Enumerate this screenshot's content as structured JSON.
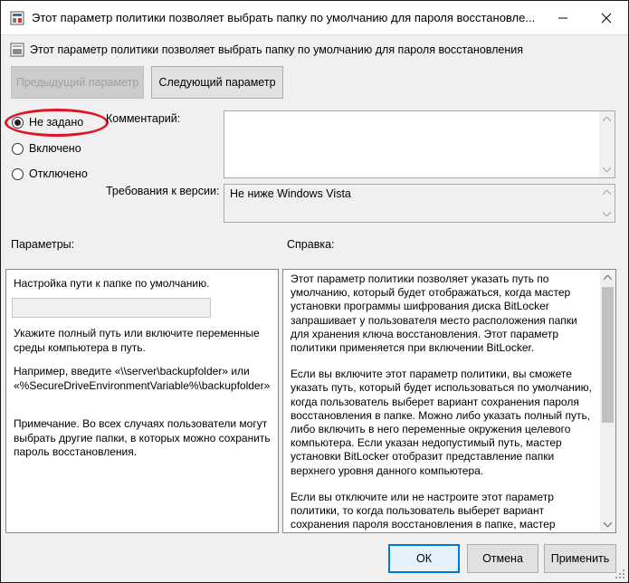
{
  "window": {
    "title": "Этот параметр политики позволяет выбрать папку по умолчанию для пароля восстановле...",
    "icons": {
      "app": "policy-window-icon",
      "minimize": "minimize-icon",
      "close": "close-icon"
    }
  },
  "policy": {
    "heading": "Этот параметр политики позволяет выбрать папку по умолчанию для пароля восстановления",
    "icon": "policy-setting-icon"
  },
  "nav": {
    "prev_label": "Предыдущий параметр",
    "next_label": "Следующий параметр"
  },
  "state": {
    "options": [
      {
        "label": "Не задано",
        "checked": true
      },
      {
        "label": "Включено",
        "checked": false
      },
      {
        "label": "Отключено",
        "checked": false
      }
    ]
  },
  "comment": {
    "label": "Комментарий:",
    "value": ""
  },
  "version": {
    "label": "Требования к версии:",
    "value": "Не ниже Windows Vista"
  },
  "options_pane": {
    "label": "Параметры:",
    "line1": "Настройка пути к папке по умолчанию.",
    "path_value": "",
    "line2": "Укажите полный путь или включите переменные среды компьютера в путь.",
    "line3": "Например, введите «\\\\server\\backupfolder» или «%SecureDriveEnvironmentVariable%\\backupfolder»",
    "line4": "Примечание. Во всех случаях пользователи могут выбрать другие папки, в которых можно сохранить пароль восстановления."
  },
  "help_pane": {
    "label": "Справка:",
    "paragraphs": [
      "Этот параметр политики позволяет указать путь по умолчанию, который будет отображаться, когда мастер установки программы шифрования диска BitLocker запрашивает у пользователя место расположения папки для хранения ключа восстановления. Этот параметр политики применяется при включении BitLocker.",
      "Если вы включите этот параметр политики, вы сможете указать путь, который будет использоваться по умолчанию, когда пользователь выберет вариант сохранения пароля восстановления в папке. Можно либо указать полный путь, либо включить в него переменные окружения целевого компьютера. Если указан недопустимый путь, мастер установки BitLocker отобразит представление папки верхнего уровня данного компьютера.",
      "Если вы отключите или не настроите этот параметр политики, то когда пользователь выберет вариант сохранения пароля восстановления в папке, мастер"
    ]
  },
  "footer": {
    "ok_label": "ОК",
    "cancel_label": "Отмена",
    "apply_label": "Применить"
  },
  "colors": {
    "highlight_circle": "#e0152a",
    "default_button_border": "#0078d7"
  }
}
